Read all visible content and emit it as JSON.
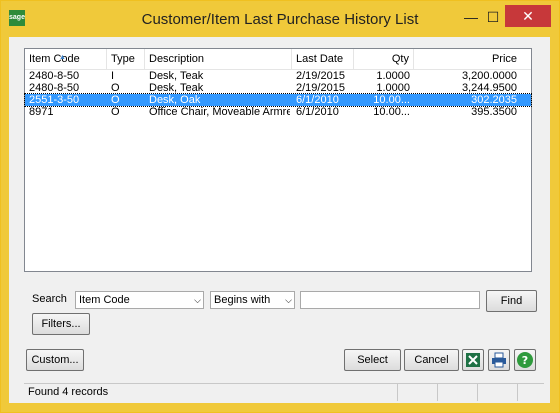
{
  "window": {
    "title": "Customer/Item Last Purchase History List",
    "app_icon_text": "sage"
  },
  "titlebar": {
    "minimize": "—",
    "maximize": "☐",
    "close": "✕"
  },
  "list": {
    "columns": [
      "Item Code",
      "Type",
      "Description",
      "Last Date",
      "Qty",
      "Price"
    ],
    "rows": [
      {
        "code": "2480-8-50",
        "type": "I",
        "description": "Desk, Teak",
        "date": "2/19/2015",
        "qty": "1.0000",
        "price": "3,200.0000",
        "selected": false
      },
      {
        "code": "2480-8-50",
        "type": "O",
        "description": "Desk, Teak",
        "date": "2/19/2015",
        "qty": "1.0000",
        "price": "3,244.9500",
        "selected": false
      },
      {
        "code": "2551-3-50",
        "type": "O",
        "description": "Desk, Oak",
        "date": "6/1/2010",
        "qty": "10.00...",
        "price": "302.2035",
        "selected": true
      },
      {
        "code": "8971",
        "type": "O",
        "description": "Office Chair, Moveable Armrest",
        "date": "6/1/2010",
        "qty": "10.00...",
        "price": "395.3500",
        "selected": false
      }
    ]
  },
  "search": {
    "label": "Search",
    "field": "Item Code",
    "operator": "Begins with",
    "value": "",
    "find_label": "Find",
    "filters_label": "Filters..."
  },
  "buttons": {
    "custom": "Custom...",
    "select": "Select",
    "cancel": "Cancel"
  },
  "status": {
    "text": "Found 4 records"
  },
  "colors": {
    "titlebar": "#f0c93a",
    "selection": "#3399ff",
    "close": "#c7383a"
  }
}
